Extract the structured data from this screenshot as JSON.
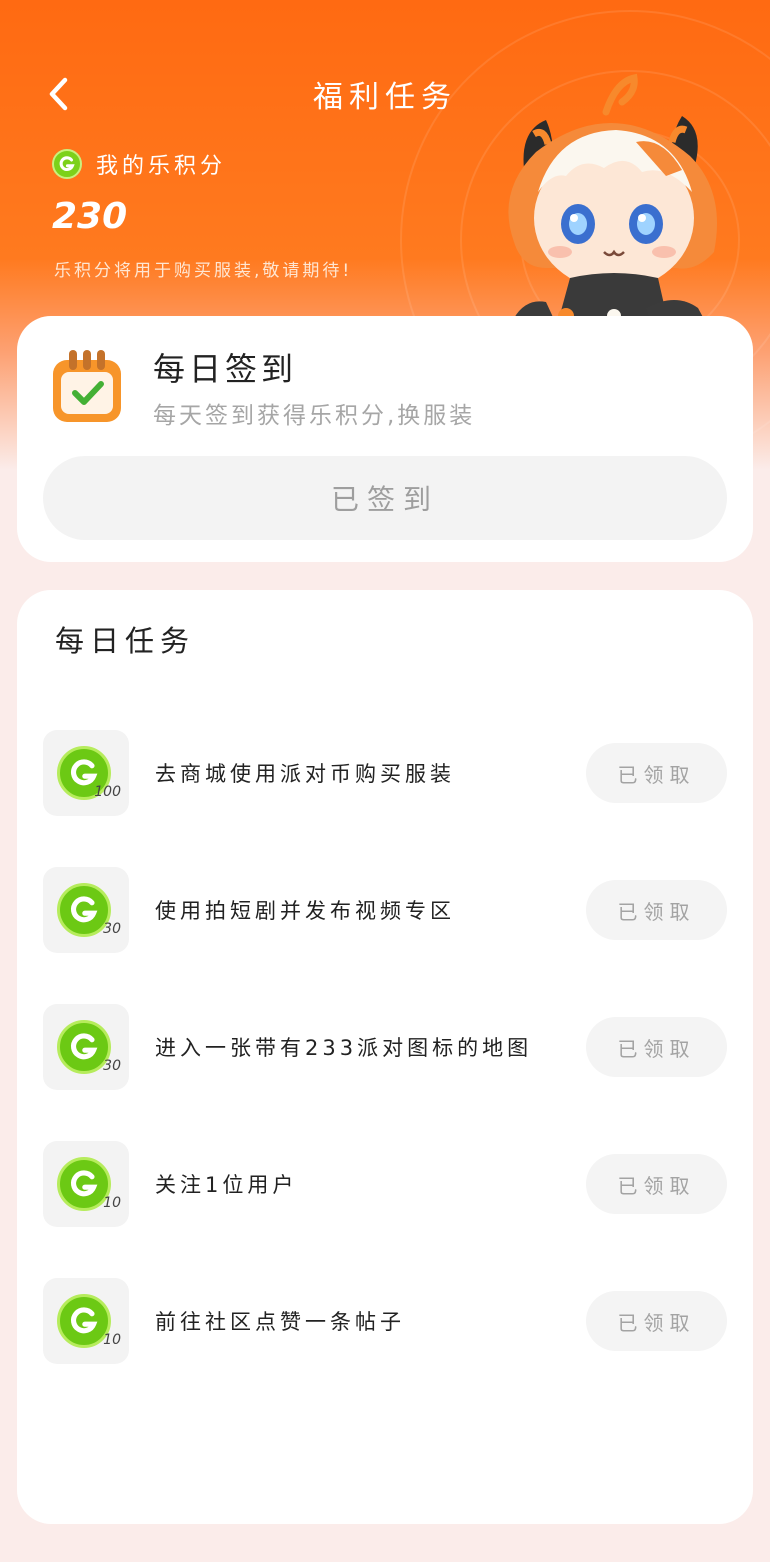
{
  "header": {
    "title": "福利任务",
    "points_label": "我的乐积分",
    "points_value": "230",
    "points_note": "乐积分将用于购买服装,敬请期待!"
  },
  "checkin": {
    "title": "每日签到",
    "subtitle": "每天签到获得乐积分,换服装",
    "button_label": "已签到"
  },
  "tasks": {
    "title": "每日任务",
    "items": [
      {
        "label": "去商城使用派对币购买服装",
        "reward": "100",
        "button": "已领取"
      },
      {
        "label": "使用拍短剧并发布视频专区",
        "reward": "30",
        "button": "已领取"
      },
      {
        "label": "进入一张带有233派对图标的地图",
        "reward": "30",
        "button": "已领取"
      },
      {
        "label": "关注1位用户",
        "reward": "10",
        "button": "已领取"
      },
      {
        "label": "前往社区点赞一条帖子",
        "reward": "10",
        "button": "已领取"
      }
    ]
  },
  "colors": {
    "accent_orange": "#ff6a12",
    "coin_green": "#6cc914",
    "background": "#fbecea"
  }
}
